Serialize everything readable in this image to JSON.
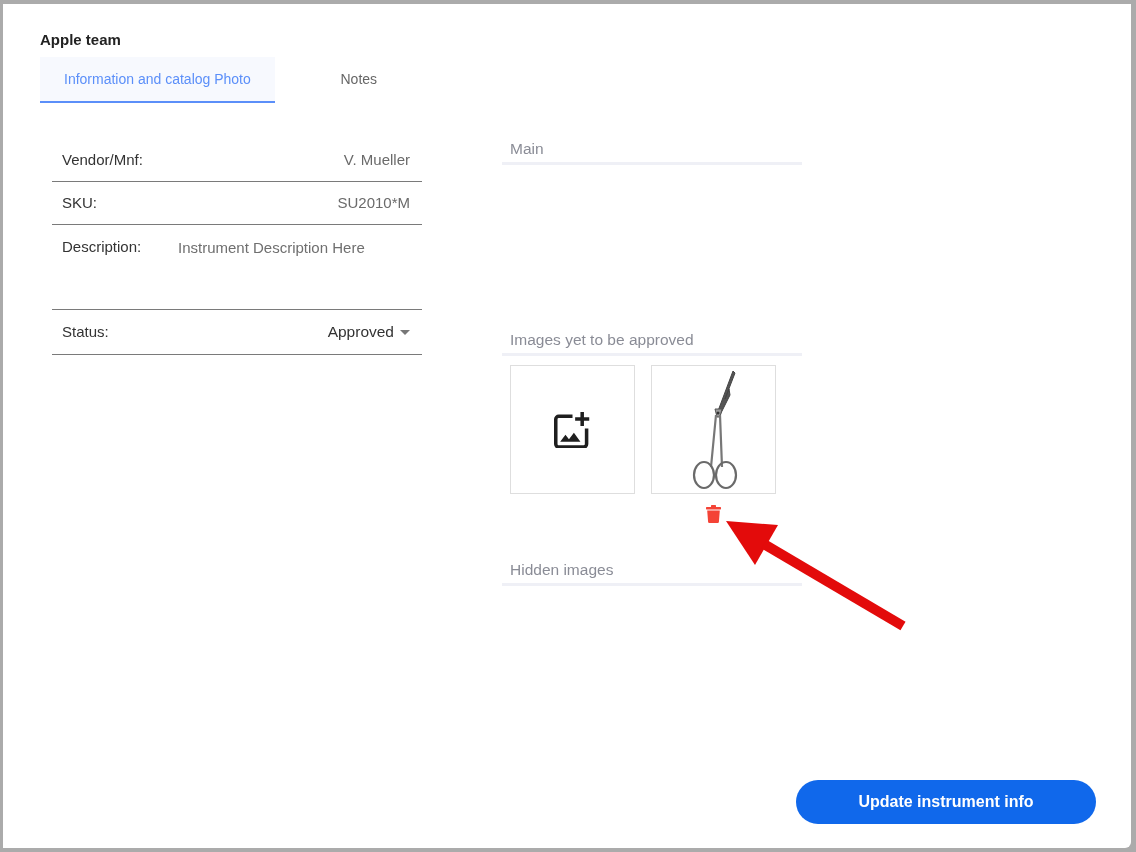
{
  "dialog": {
    "title": "Apple team"
  },
  "tabs": [
    {
      "label": "Information and catalog Photo",
      "selected": true
    },
    {
      "label": "Notes",
      "selected": false
    }
  ],
  "fields": [
    {
      "kind": "text",
      "label": "Vendor/Mnf:",
      "value": "V. Mueller"
    },
    {
      "kind": "text",
      "label": "SKU:",
      "value": "SU2010*M"
    },
    {
      "kind": "textarea",
      "label": "Description:",
      "placeholder": "Instrument Description Here"
    },
    {
      "kind": "select",
      "label": "Status:",
      "value": "Approved"
    }
  ],
  "image_sections": [
    {
      "title": "Main"
    },
    {
      "title": "Images yet to be approved",
      "tiles": [
        {
          "kind": "add"
        },
        {
          "kind": "photo"
        }
      ]
    },
    {
      "title": "Hidden images"
    }
  ],
  "submit_button": {
    "label": "Update instrument info"
  }
}
